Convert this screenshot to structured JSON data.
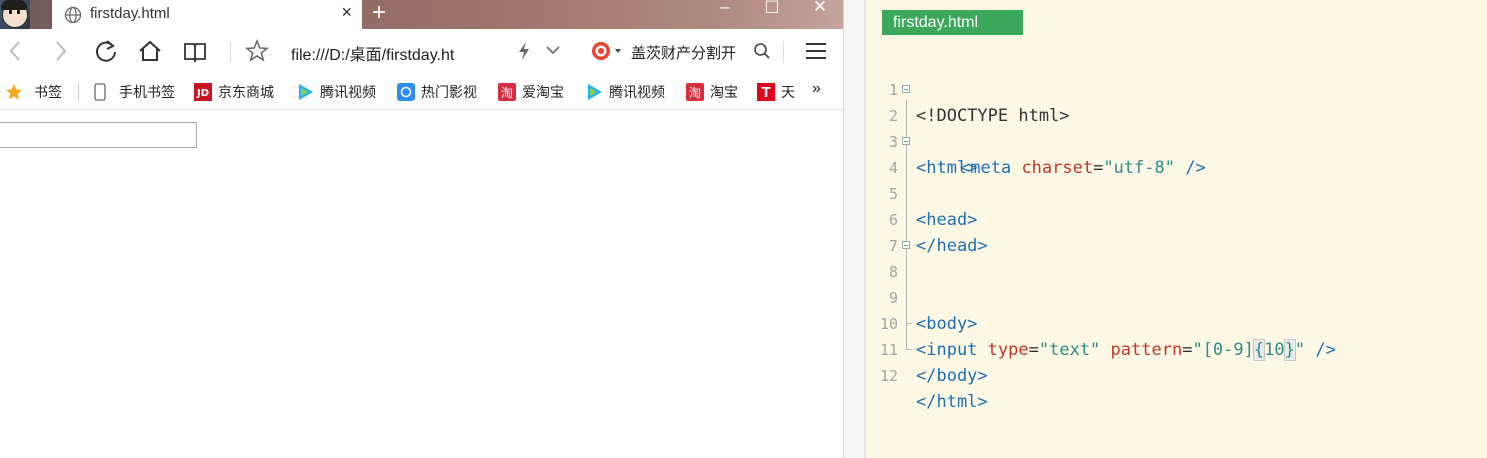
{
  "browser": {
    "tab_title": "firstday.html",
    "tab_close": "×",
    "new_tab": "+",
    "window_controls": {
      "minimize": "–",
      "maximize": "☐",
      "close": "✕"
    },
    "address": "file:///D:/桌面/firstday.ht",
    "search_text": "盖茨财产分割开",
    "bookmarks": [
      {
        "label": "书签",
        "icon": "star-icon"
      },
      {
        "label": "手机书签",
        "icon": "phone-icon"
      },
      {
        "label": "京东商城",
        "icon": "jd-icon"
      },
      {
        "label": "腾讯视频",
        "icon": "tencent-video-icon"
      },
      {
        "label": "热门影视",
        "icon": "movie-icon"
      },
      {
        "label": "爱淘宝",
        "icon": "taobao-icon"
      },
      {
        "label": "腾讯视频",
        "icon": "tencent-video-icon"
      },
      {
        "label": "淘宝",
        "icon": "taobao-icon"
      },
      {
        "label": "天",
        "icon": "tmall-icon"
      }
    ],
    "more_bookmarks": "»",
    "input_value": ""
  },
  "editor": {
    "file_tab": "firstday.html",
    "line_numbers": [
      "1",
      "2",
      "3",
      "4",
      "5",
      "6",
      "7",
      "8",
      "9",
      "10",
      "11",
      "12"
    ],
    "code": {
      "l1": "<!DOCTYPE html>",
      "l2_tag": "<html>",
      "l3_open": "<meta",
      "l3_attr": "charset",
      "l3_eq": "=",
      "l3_val": "\"utf-8\"",
      "l3_close": " />",
      "l4": "<head>",
      "l6": "</head>",
      "l8": "<body>",
      "l10_open": "<input",
      "l10_attr1": "type",
      "l10_eq1": "=",
      "l10_val1": "\"text\"",
      "l10_attr2": "pattern",
      "l10_eq2": "=",
      "l10_val2a": "\"[0-9]",
      "l10_brace_open": "{",
      "l10_num": "10",
      "l10_brace_close": "}",
      "l10_val2b": "\"",
      "l10_close": " />",
      "l11": "</body>",
      "l12": "</html>"
    }
  },
  "colors": {
    "tab_green": "#3ca85c",
    "editor_bg": "#fdf8e4",
    "tag_blue": "#1f6fb3",
    "attr_red": "#c0392b",
    "string_teal": "#2a8d8a"
  }
}
